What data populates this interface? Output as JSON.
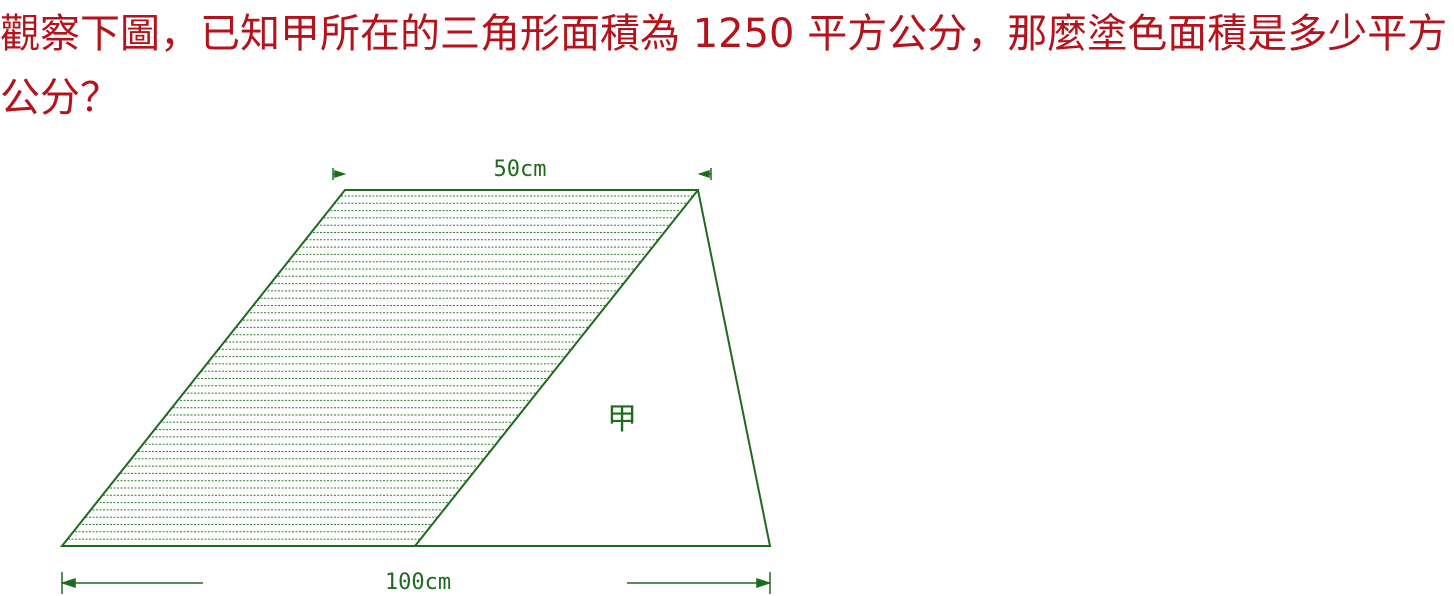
{
  "question": {
    "text": "觀察下圖，已知甲所在的三角形面積為 1250 平方公分，那麼塗色面積是多少平方公分？"
  },
  "figure": {
    "top_label": "50cm",
    "bottom_label": "100cm",
    "region_label": "甲",
    "colors": {
      "question_text": "#b5121b",
      "figure_stroke": "#1e6b1e",
      "hatch": "#2e7d2e"
    }
  }
}
